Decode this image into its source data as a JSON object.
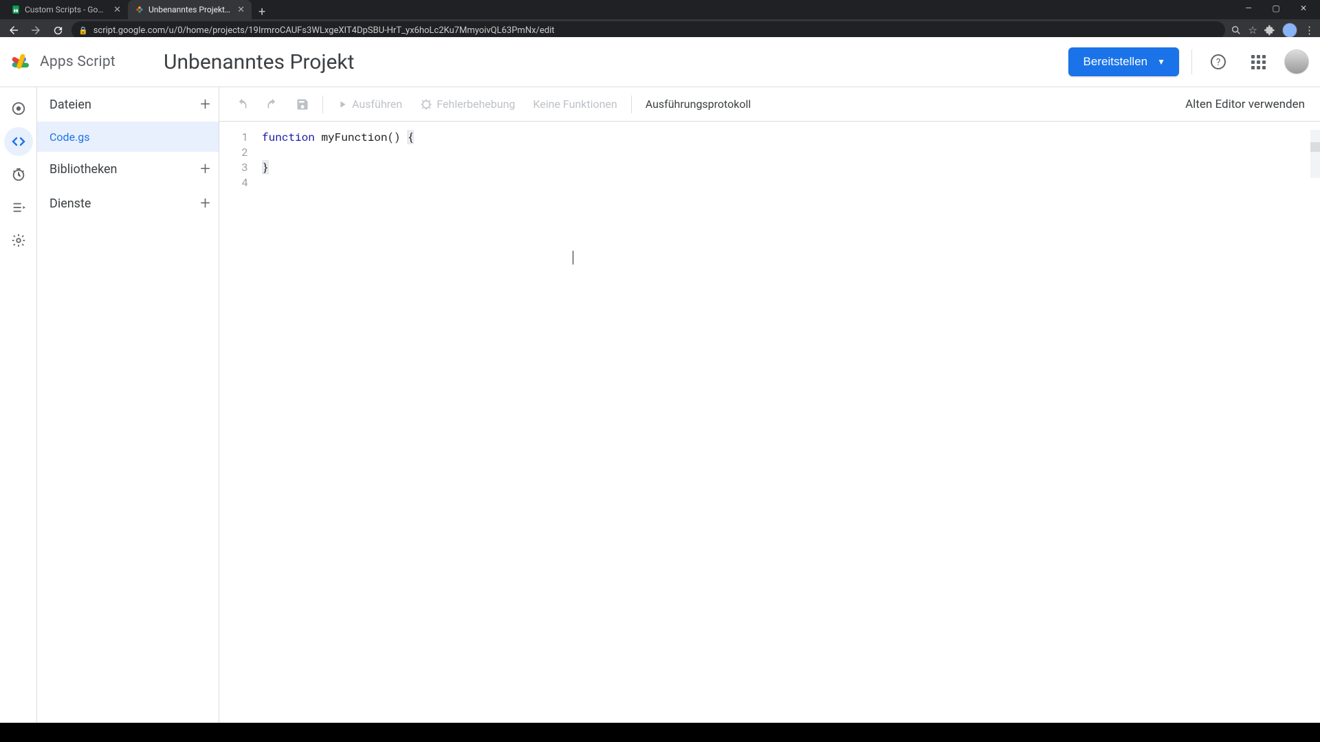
{
  "browser": {
    "tabs": [
      {
        "title": "Custom Scripts - Google Tabellen",
        "active": false
      },
      {
        "title": "Unbenanntes Projekt - Projekt-E",
        "active": true
      }
    ],
    "url": "script.google.com/u/0/home/projects/19IrmroCAUFs3WLxgeXIT4DpSBU-HrT_yx6hoLc2Ku7MmyoivQL63PmNx/edit"
  },
  "header": {
    "product": "Apps Script",
    "project_title": "Unbenanntes Projekt",
    "deploy_label": "Bereitstellen"
  },
  "sidepanel": {
    "files_label": "Dateien",
    "libraries_label": "Bibliotheken",
    "services_label": "Dienste",
    "files": [
      {
        "name": "Code.gs",
        "active": true
      }
    ]
  },
  "toolbar": {
    "run_label": "Ausführen",
    "debug_label": "Fehlerbehebung",
    "functions_label": "Keine Funktionen",
    "log_label": "Ausführungsprotokoll",
    "legacy_label": "Alten Editor verwenden"
  },
  "editor": {
    "lines": [
      "1",
      "2",
      "3",
      "4"
    ],
    "code": {
      "l1_kw": "function",
      "l1_name": " myFunction() ",
      "l1_brace": "{",
      "l2": "  ",
      "l3_brace": "}",
      "l4": ""
    }
  }
}
